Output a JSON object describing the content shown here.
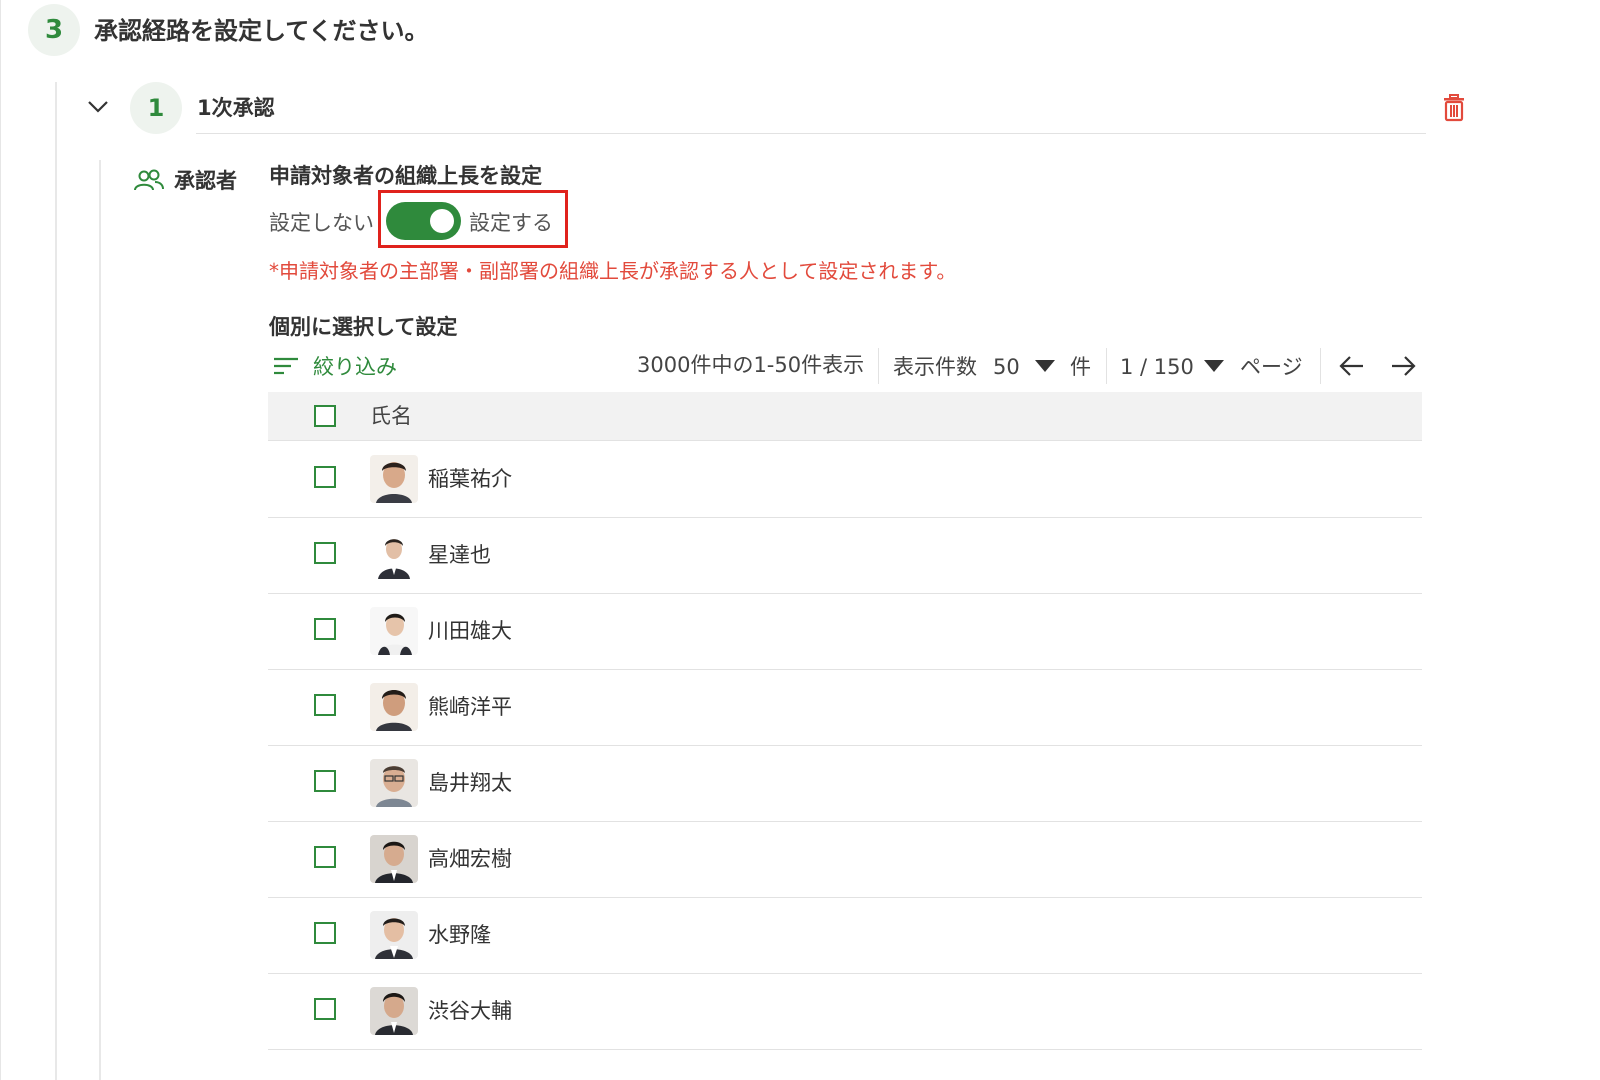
{
  "step": {
    "number": "3",
    "title": "承認経路を設定してください。"
  },
  "stage": {
    "number": "1",
    "title": "1次承認"
  },
  "approver": {
    "label": "承認者"
  },
  "org_head": {
    "title": "申請対象者の組織上長を設定",
    "off_label": "設定しない",
    "on_label": "設定する",
    "enabled": true,
    "note": "*申請対象者の主部署・副部署の組織上長が承認する人として設定されます。"
  },
  "individual": {
    "title": "個別に選択して設定"
  },
  "toolbar": {
    "filter_label": "絞り込み",
    "range_text": "3000件中の1-50件表示",
    "per_page_label": "表示件数",
    "per_page_value": "50",
    "per_page_unit": "件",
    "page_value": "1 / 150",
    "page_unit": "ページ"
  },
  "table": {
    "header_name": "氏名",
    "rows": [
      {
        "name": "稲葉祐介"
      },
      {
        "name": "星達也"
      },
      {
        "name": "川田雄大"
      },
      {
        "name": "熊崎洋平"
      },
      {
        "name": "島井翔太"
      },
      {
        "name": "高畑宏樹"
      },
      {
        "name": "水野隆"
      },
      {
        "name": "渋谷大輔"
      }
    ]
  },
  "colors": {
    "accent": "#2f8a3c",
    "danger": "#e24a3c",
    "highlight": "#e0221c"
  },
  "icons": {
    "collapse": "chevron-down-icon",
    "delete": "trash-icon",
    "approver": "users-icon",
    "filter": "filter-lines-icon",
    "dropdown": "caret-down-icon",
    "prev": "arrow-left-icon",
    "next": "arrow-right-icon"
  }
}
